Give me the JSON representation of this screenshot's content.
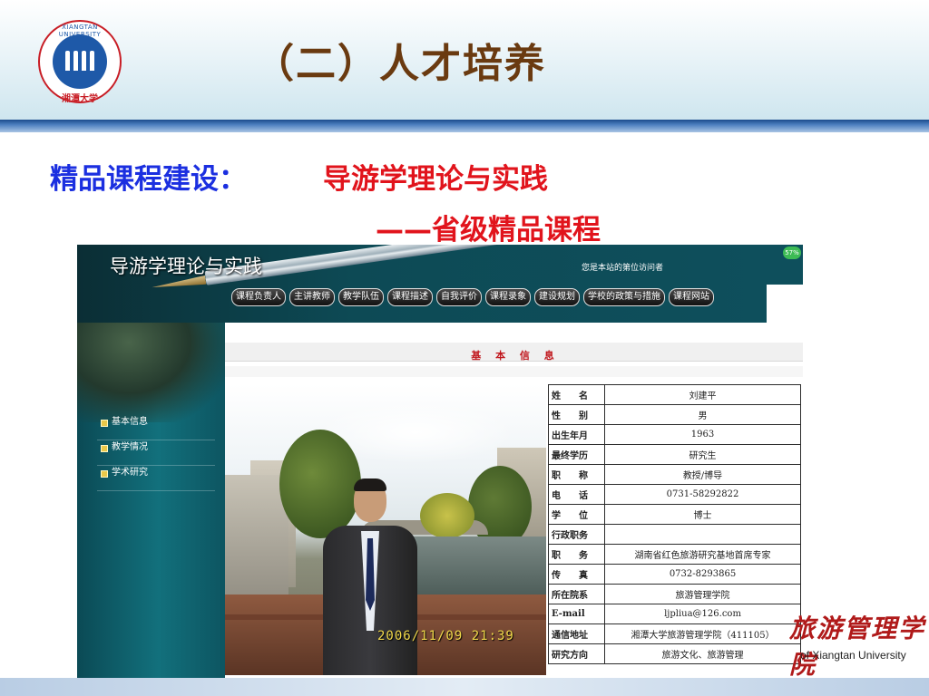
{
  "slide": {
    "title": "（二）人才培养",
    "course_label": "精品课程建设：",
    "course_name": "导游学理论与实践",
    "course_level": "——省级精品课程",
    "footer_brand": "旅游管理学院",
    "footer_en": "of Xiangtan University"
  },
  "logo": {
    "ring_text": "XIANGTAN UNIVERSITY",
    "seal_text": "湘潭大学"
  },
  "site": {
    "title": "导游学理论与实践",
    "visitor_text": "您是本站的第位访问者",
    "zoom_badge": "57%",
    "nav": [
      "课程负责人",
      "主讲教师",
      "教学队伍",
      "课程描述",
      "自我评价",
      "课程录象",
      "建设规划",
      "学校的政策与措施",
      "课程网站"
    ],
    "side_menu": [
      "基本信息",
      "教学情况",
      "学术研究"
    ],
    "section_title": "基 本 信 息",
    "photo_timestamp": "2006/11/09 21:39",
    "info": [
      {
        "k": "姓　　名",
        "v": "刘建平"
      },
      {
        "k": "性　　别",
        "v": "男"
      },
      {
        "k": "出生年月",
        "v": "1963"
      },
      {
        "k": "最终学历",
        "v": "研究生"
      },
      {
        "k": "职　　称",
        "v": "教授/博导"
      },
      {
        "k": "电　　话",
        "v": "0731-58292822"
      },
      {
        "k": "学　　位",
        "v": "博士"
      },
      {
        "k": "行政职务",
        "v": ""
      },
      {
        "k": "职　　务",
        "v": "湖南省红色旅游研究基地首席专家"
      },
      {
        "k": "传　　真",
        "v": "0732-8293865"
      },
      {
        "k": "所在院系",
        "v": "旅游管理学院"
      },
      {
        "k": "E-mail",
        "v": "ljpliua@126.com"
      },
      {
        "k": "通信地址",
        "v": "湘潭大学旅游管理学院（411105）"
      },
      {
        "k": "研究方向",
        "v": "旅游文化、旅游管理"
      }
    ]
  },
  "colors": {
    "title_brown": "#6a3a10",
    "label_blue": "#1b2fe0",
    "accent_red": "#e1141c",
    "site_teal": "#0e4f5c"
  }
}
